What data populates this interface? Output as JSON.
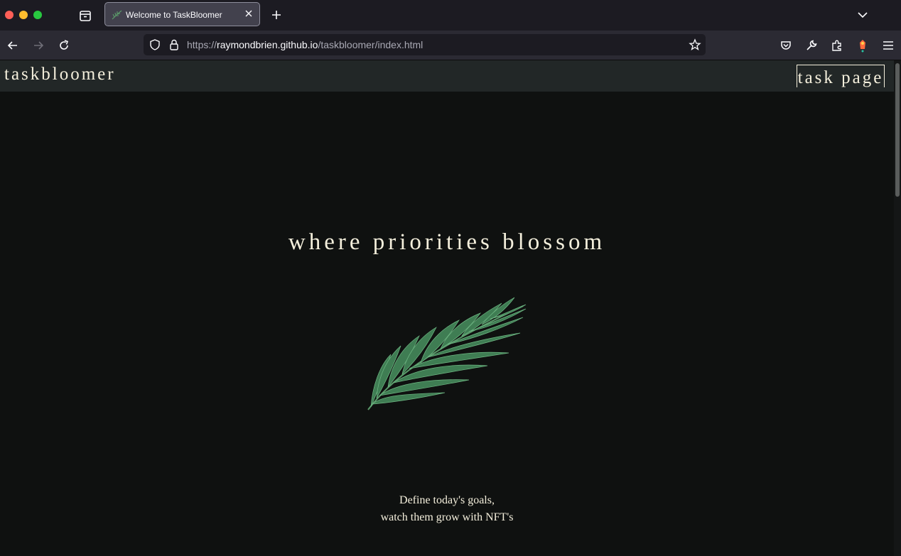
{
  "browser": {
    "tab_title": "Welcome to TaskBloomer",
    "url_prefix": "https://",
    "url_host": "raymondbrien.github.io",
    "url_path": "/taskbloomer/index.html"
  },
  "site": {
    "brand": "taskbloomer",
    "nav_link": "task page",
    "hero_title": "where priorities blossom",
    "tagline_line1": "Define today's goals,",
    "tagline_line2": "watch them grow with NFT's"
  },
  "colors": {
    "page_bg": "#0f1110",
    "header_bg": "#222727",
    "text_cream": "#f4efdc",
    "leaf_green": "#4f9a63"
  },
  "icons": {
    "sprig": "rosemary-sprig-illustration"
  }
}
